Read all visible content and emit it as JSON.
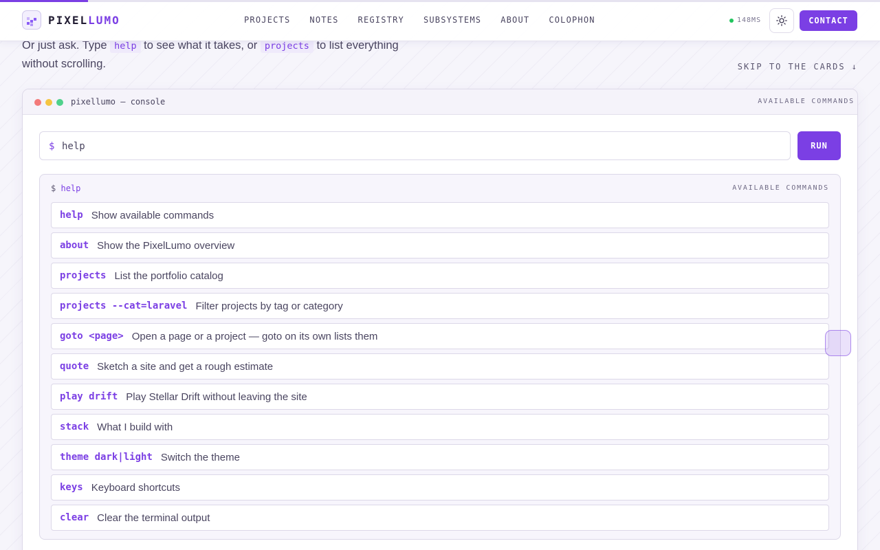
{
  "page": {
    "scroll_progress": 0.1,
    "accent_color": "#7b3fe4"
  },
  "brand": {
    "name_part1": "PIXEL",
    "name_part2": "LUMO",
    "icon": "pixel-logo-icon"
  },
  "nav": {
    "links": [
      "PROJECTS",
      "NOTES",
      "REGISTRY",
      "SUBSYSTEMS",
      "ABOUT",
      "COLOPHON"
    ],
    "latency": "148MS",
    "theme_icon": "sun-icon",
    "contact_label": "CONTACT"
  },
  "intro": {
    "text_1": "Or just ask. Type ",
    "code_1": "help",
    "text_2": " to see what it takes, or ",
    "code_2": "projects",
    "text_3": " to list everything without scrolling."
  },
  "skip_link": "SKIP TO THE CARDS ↓",
  "console": {
    "title": "pixellumo — console",
    "header_right": "AVAILABLE COMMANDS",
    "prompt": "$",
    "input_value": "help",
    "run_label": "RUN",
    "output": {
      "prompt": "$",
      "command": "help",
      "label": "AVAILABLE COMMANDS",
      "commands": [
        {
          "name": "help",
          "desc": "Show available commands"
        },
        {
          "name": "about",
          "desc": "Show the PixelLumo overview"
        },
        {
          "name": "projects",
          "desc": "List the portfolio catalog"
        },
        {
          "name": "projects --cat=laravel",
          "desc": "Filter projects by tag or category"
        },
        {
          "name": "goto <page>",
          "desc": "Open a page or a project — goto on its own lists them"
        },
        {
          "name": "quote",
          "desc": "Sketch a site and get a rough estimate"
        },
        {
          "name": "play drift",
          "desc": "Play Stellar Drift without leaving the site"
        },
        {
          "name": "stack",
          "desc": "What I build with"
        },
        {
          "name": "theme dark|light",
          "desc": "Switch the theme"
        },
        {
          "name": "keys",
          "desc": "Keyboard shortcuts"
        },
        {
          "name": "clear",
          "desc": "Clear the terminal output"
        }
      ]
    }
  }
}
